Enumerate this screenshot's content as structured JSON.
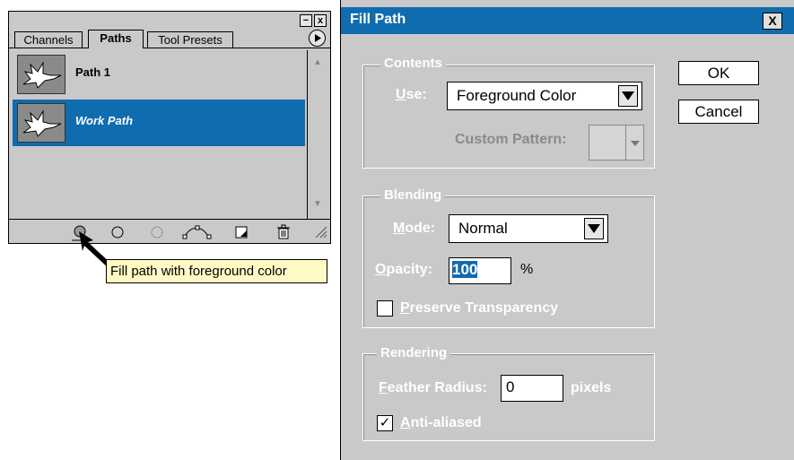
{
  "palette": {
    "minimize_label": "−",
    "close_label": "x",
    "tabs": [
      {
        "label": "Channels"
      },
      {
        "label": "Paths"
      },
      {
        "label": "Tool Presets"
      }
    ],
    "rows": [
      {
        "label": "Path 1",
        "selected": false
      },
      {
        "label": "Work Path",
        "selected": true
      }
    ],
    "tooltip": "Fill path with foreground color"
  },
  "dialog": {
    "title": "Fill Path",
    "close_label": "X",
    "ok_label": "OK",
    "cancel_label": "Cancel",
    "contents": {
      "group_label": "Contents",
      "use_label_u": "U",
      "use_label_rest": "se:",
      "use_value": "Foreground Color",
      "custom_pattern_label": "Custom Pattern:"
    },
    "blending": {
      "group_label": "Blending",
      "mode_label_u": "M",
      "mode_label_rest": "ode:",
      "mode_value": "Normal",
      "opacity_label_u": "O",
      "opacity_label_rest": "pacity:",
      "opacity_value": "100",
      "opacity_unit": "%",
      "preserve_label_u": "P",
      "preserve_label_rest": "reserve Transparency",
      "preserve_checked": false
    },
    "rendering": {
      "group_label": "Rendering",
      "feather_label_u": "F",
      "feather_label_rest": "eather Radius:",
      "feather_value": "0",
      "feather_unit": "pixels",
      "antialias_label_u": "A",
      "antialias_label_rest": "nti-aliased",
      "antialias_checked": true,
      "antialias_mark": "✓"
    }
  }
}
